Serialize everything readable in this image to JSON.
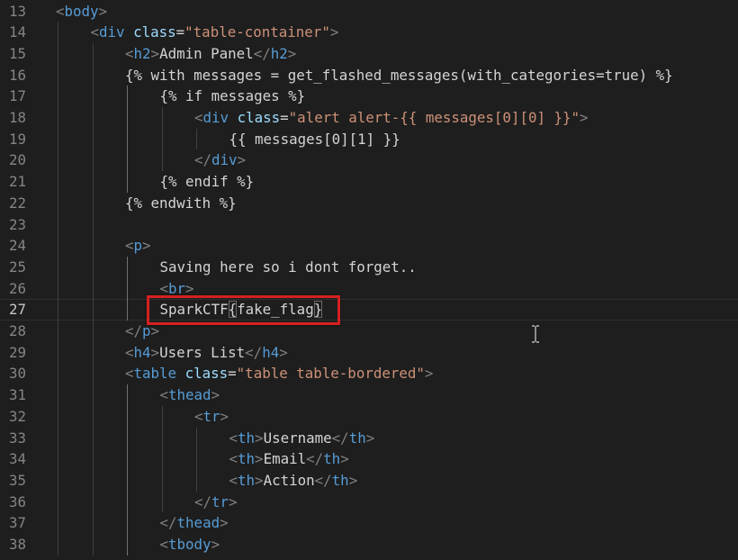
{
  "editor": {
    "language": "html-jinja",
    "current_line": 27,
    "lines": [
      {
        "n": "13",
        "indent": 0,
        "tokens": [
          [
            "punc",
            "<"
          ],
          [
            "tag",
            "body"
          ],
          [
            "punc",
            ">"
          ]
        ]
      },
      {
        "n": "14",
        "indent": 1,
        "tokens": [
          [
            "punc",
            "<"
          ],
          [
            "tag",
            "div"
          ],
          [
            "text",
            " "
          ],
          [
            "attr",
            "class"
          ],
          [
            "text",
            "="
          ],
          [
            "str",
            "\"table-container\""
          ],
          [
            "punc",
            ">"
          ]
        ]
      },
      {
        "n": "15",
        "indent": 2,
        "tokens": [
          [
            "punc",
            "<"
          ],
          [
            "tag",
            "h2"
          ],
          [
            "punc",
            ">"
          ],
          [
            "text",
            "Admin Panel"
          ],
          [
            "punc",
            "</"
          ],
          [
            "tag",
            "h2"
          ],
          [
            "punc",
            ">"
          ]
        ]
      },
      {
        "n": "16",
        "indent": 2,
        "tokens": [
          [
            "text",
            "{% with messages = get_flashed_messages(with_categories=true) %}"
          ]
        ]
      },
      {
        "n": "17",
        "indent": 3,
        "tokens": [
          [
            "text",
            "{% if messages %}"
          ]
        ]
      },
      {
        "n": "18",
        "indent": 4,
        "tokens": [
          [
            "punc",
            "<"
          ],
          [
            "tag",
            "div"
          ],
          [
            "text",
            " "
          ],
          [
            "attr",
            "class"
          ],
          [
            "text",
            "="
          ],
          [
            "str",
            "\"alert alert-{{ messages[0][0] }}\""
          ],
          [
            "punc",
            ">"
          ]
        ]
      },
      {
        "n": "19",
        "indent": 5,
        "tokens": [
          [
            "text",
            "{{ messages[0][1] }}"
          ]
        ]
      },
      {
        "n": "20",
        "indent": 4,
        "tokens": [
          [
            "punc",
            "</"
          ],
          [
            "tag",
            "div"
          ],
          [
            "punc",
            ">"
          ]
        ]
      },
      {
        "n": "21",
        "indent": 3,
        "tokens": [
          [
            "text",
            "{% endif %}"
          ]
        ]
      },
      {
        "n": "22",
        "indent": 2,
        "tokens": [
          [
            "text",
            "{% endwith %}"
          ]
        ]
      },
      {
        "n": "23",
        "indent": 0,
        "tokens": []
      },
      {
        "n": "24",
        "indent": 2,
        "tokens": [
          [
            "punc",
            "<"
          ],
          [
            "tag",
            "p"
          ],
          [
            "punc",
            ">"
          ]
        ]
      },
      {
        "n": "25",
        "indent": 3,
        "tokens": [
          [
            "text",
            "Saving here so i dont forget.."
          ]
        ]
      },
      {
        "n": "26",
        "indent": 3,
        "tokens": [
          [
            "punc",
            "<"
          ],
          [
            "tag",
            "br"
          ],
          [
            "punc",
            ">"
          ]
        ]
      },
      {
        "n": "27",
        "indent": 3,
        "tokens": [
          [
            "text",
            "SparkCTF"
          ],
          [
            "hl",
            "{"
          ],
          [
            "text",
            "fake_flag"
          ],
          [
            "hl",
            "}"
          ]
        ]
      },
      {
        "n": "28",
        "indent": 2,
        "tokens": [
          [
            "punc",
            "</"
          ],
          [
            "tag",
            "p"
          ],
          [
            "punc",
            ">"
          ]
        ]
      },
      {
        "n": "29",
        "indent": 2,
        "tokens": [
          [
            "punc",
            "<"
          ],
          [
            "tag",
            "h4"
          ],
          [
            "punc",
            ">"
          ],
          [
            "text",
            "Users List"
          ],
          [
            "punc",
            "</"
          ],
          [
            "tag",
            "h4"
          ],
          [
            "punc",
            ">"
          ]
        ]
      },
      {
        "n": "30",
        "indent": 2,
        "tokens": [
          [
            "punc",
            "<"
          ],
          [
            "tag",
            "table"
          ],
          [
            "text",
            " "
          ],
          [
            "attr",
            "class"
          ],
          [
            "text",
            "="
          ],
          [
            "str",
            "\"table table-bordered\""
          ],
          [
            "punc",
            ">"
          ]
        ]
      },
      {
        "n": "31",
        "indent": 3,
        "tokens": [
          [
            "punc",
            "<"
          ],
          [
            "tag",
            "thead"
          ],
          [
            "punc",
            ">"
          ]
        ]
      },
      {
        "n": "32",
        "indent": 4,
        "tokens": [
          [
            "punc",
            "<"
          ],
          [
            "tag",
            "tr"
          ],
          [
            "punc",
            ">"
          ]
        ]
      },
      {
        "n": "33",
        "indent": 5,
        "tokens": [
          [
            "punc",
            "<"
          ],
          [
            "tag",
            "th"
          ],
          [
            "punc",
            ">"
          ],
          [
            "text",
            "Username"
          ],
          [
            "punc",
            "</"
          ],
          [
            "tag",
            "th"
          ],
          [
            "punc",
            ">"
          ]
        ]
      },
      {
        "n": "34",
        "indent": 5,
        "tokens": [
          [
            "punc",
            "<"
          ],
          [
            "tag",
            "th"
          ],
          [
            "punc",
            ">"
          ],
          [
            "text",
            "Email"
          ],
          [
            "punc",
            "</"
          ],
          [
            "tag",
            "th"
          ],
          [
            "punc",
            ">"
          ]
        ]
      },
      {
        "n": "35",
        "indent": 5,
        "tokens": [
          [
            "punc",
            "<"
          ],
          [
            "tag",
            "th"
          ],
          [
            "punc",
            ">"
          ],
          [
            "text",
            "Action"
          ],
          [
            "punc",
            "</"
          ],
          [
            "tag",
            "th"
          ],
          [
            "punc",
            ">"
          ]
        ]
      },
      {
        "n": "36",
        "indent": 4,
        "tokens": [
          [
            "punc",
            "</"
          ],
          [
            "tag",
            "tr"
          ],
          [
            "punc",
            ">"
          ]
        ]
      },
      {
        "n": "37",
        "indent": 3,
        "tokens": [
          [
            "punc",
            "</"
          ],
          [
            "tag",
            "thead"
          ],
          [
            "punc",
            ">"
          ]
        ]
      },
      {
        "n": "38",
        "indent": 3,
        "tokens": [
          [
            "punc",
            "<"
          ],
          [
            "tag",
            "tbody"
          ],
          [
            "punc",
            ">"
          ]
        ]
      }
    ]
  },
  "annotation": {
    "label": "highlighted-flag-line",
    "color": "#d62020"
  },
  "cursor": {
    "type": "i-beam-icon"
  }
}
